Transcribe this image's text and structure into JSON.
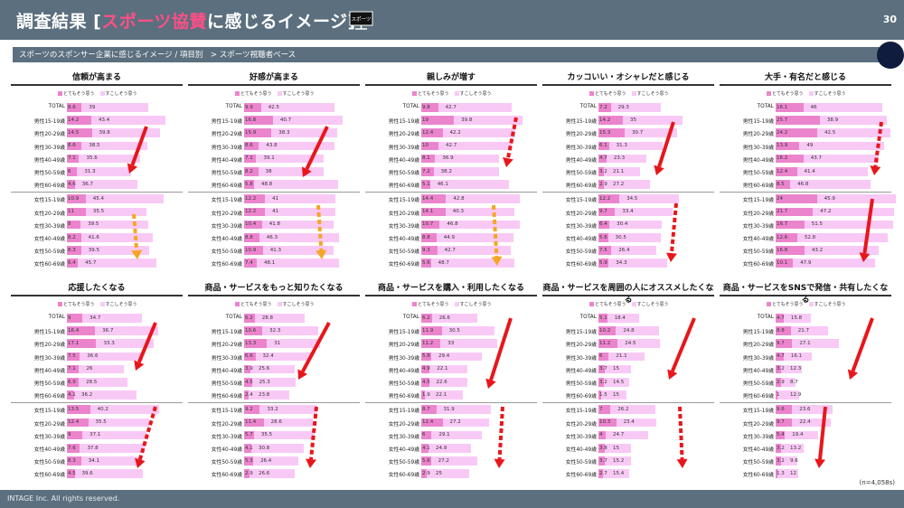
{
  "header": {
    "title_prefix": "調査結果 [",
    "title_highlight": "スポーツ協賛",
    "title_suffix": "に感じるイメージ]",
    "icon_text": "スポーツ",
    "page_number": "30"
  },
  "subtitle": "スポーツのスポンサー企業に感じるイメージ / 項目別　> スポーツ視聴者ベース",
  "legend": {
    "strong": "とてもそう思う",
    "somewhat": "すこしそう思う"
  },
  "colors": {
    "strong": "#ec84cd",
    "somewhat": "#f9c9f6",
    "arrow": "#e8161b",
    "arrow_alt": "#f5a623",
    "header": "#5b6f7e"
  },
  "row_labels": [
    "TOTAL",
    "男性15-19歳",
    "男性20-29歳",
    "男性30-39歳",
    "男性40-49歳",
    "男性50-59歳",
    "男性60-69歳",
    "女性15-19歳",
    "女性20-29歳",
    "女性30-39歳",
    "女性40-49歳",
    "女性50-59歳",
    "女性60-69歳"
  ],
  "chart_data": [
    {
      "type": "bar",
      "title": "信頼が高まる",
      "categories": [
        "TOTAL",
        "男性15-19歳",
        "男性20-29歳",
        "男性30-39歳",
        "男性40-49歳",
        "男性50-59歳",
        "男性60-69歳",
        "女性15-19歳",
        "女性20-29歳",
        "女性30-39歳",
        "女性40-49歳",
        "女性50-59歳",
        "女性60-69歳"
      ],
      "series": [
        {
          "name": "とてもそう思う",
          "values": [
            8.6,
            14.2,
            14.5,
            8.6,
            7.1,
            6.0,
            4.6,
            10.9,
            11.0,
            8.0,
            8.2,
            8.3,
            6.4
          ]
        },
        {
          "name": "すこしそう思う",
          "values": [
            39.0,
            43.4,
            39.8,
            38.5,
            35.6,
            31.3,
            36.7,
            45.4,
            35.5,
            39.5,
            41.6,
            39.5,
            45.7
          ]
        }
      ]
    },
    {
      "type": "bar",
      "title": "好感が高まる",
      "categories": [
        "TOTAL",
        "男性15-19歳",
        "男性20-29歳",
        "男性30-39歳",
        "男性40-49歳",
        "男性50-59歳",
        "男性60-69歳",
        "女性15-19歳",
        "女性20-29歳",
        "女性30-39歳",
        "女性40-49歳",
        "女性50-59歳",
        "女性60-69歳"
      ],
      "series": [
        {
          "name": "とてもそう思う",
          "values": [
            9.9,
            16.8,
            15.9,
            8.6,
            7.1,
            8.2,
            5.8,
            12.2,
            12.2,
            10.4,
            8.8,
            10.9,
            7.4
          ]
        },
        {
          "name": "すこしそう思う",
          "values": [
            42.5,
            40.7,
            38.3,
            43.8,
            39.1,
            38.0,
            48.8,
            41.0,
            41.0,
            41.8,
            46.3,
            41.3,
            48.1
          ]
        }
      ]
    },
    {
      "type": "bar",
      "title": "親しみが増す",
      "categories": [
        "TOTAL",
        "男性15-19歳",
        "男性20-29歳",
        "男性30-39歳",
        "男性40-49歳",
        "男性50-59歳",
        "男性60-69歳",
        "女性15-19歳",
        "女性20-29歳",
        "女性30-39歳",
        "女性40-49歳",
        "女性50-59歳",
        "女性60-69歳"
      ],
      "series": [
        {
          "name": "とてもそう思う",
          "values": [
            9.8,
            19.0,
            12.4,
            10.0,
            8.1,
            7.2,
            5.1,
            14.4,
            14.1,
            10.7,
            8.8,
            9.3,
            5.6
          ]
        },
        {
          "name": "すこしそう思う",
          "values": [
            42.7,
            39.8,
            42.2,
            42.7,
            36.9,
            38.2,
            46.1,
            42.8,
            40.3,
            46.8,
            44.9,
            42.7,
            48.7
          ]
        }
      ]
    },
    {
      "type": "bar",
      "title": "カッコいい・オシャレだと感じる",
      "categories": [
        "TOTAL",
        "男性15-19歳",
        "男性20-29歳",
        "男性30-39歳",
        "男性40-49歳",
        "男性50-59歳",
        "男性60-69歳",
        "女性15-19歳",
        "女性20-29歳",
        "女性30-39歳",
        "女性40-49歳",
        "女性50-59歳",
        "女性60-69歳"
      ],
      "series": [
        {
          "name": "とてもそう思う",
          "values": [
            7.2,
            14.2,
            15.3,
            6.1,
            4.7,
            3.2,
            2.9,
            12.2,
            9.7,
            6.4,
            5.6,
            7.5,
            5.9
          ]
        },
        {
          "name": "すこしそう思う",
          "values": [
            29.3,
            35.0,
            30.7,
            31.3,
            23.3,
            21.1,
            27.2,
            34.5,
            33.4,
            30.4,
            30.5,
            26.4,
            34.3
          ]
        }
      ]
    },
    {
      "type": "bar",
      "title": "大手・有名だと感じる",
      "categories": [
        "TOTAL",
        "男性15-19歳",
        "男性20-29歳",
        "男性30-39歳",
        "男性40-49歳",
        "男性50-59歳",
        "男性60-69歳",
        "女性15-19歳",
        "女性20-29歳",
        "女性30-39歳",
        "女性40-49歳",
        "女性50-59歳",
        "女性60-69歳"
      ],
      "series": [
        {
          "name": "とてもそう思う",
          "values": [
            16.1,
            25.7,
            24.2,
            13.9,
            16.2,
            12.4,
            8.5,
            24.0,
            21.7,
            16.7,
            12.6,
            16.8,
            10.1
          ]
        },
        {
          "name": "すこしそう思う",
          "values": [
            46.0,
            38.9,
            42.5,
            49.0,
            43.7,
            41.4,
            46.8,
            45.9,
            47.2,
            51.5,
            52.8,
            43.2,
            47.9
          ]
        }
      ]
    },
    {
      "type": "bar",
      "title": "応援したくなる",
      "categories": [
        "TOTAL",
        "男性15-19歳",
        "男性20-29歳",
        "男性30-39歳",
        "男性40-49歳",
        "男性50-59歳",
        "男性60-69歳",
        "女性15-19歳",
        "女性20-29歳",
        "女性30-39歳",
        "女性40-49歳",
        "女性50-59歳",
        "女性60-69歳"
      ],
      "series": [
        {
          "name": "とてもそう思う",
          "values": [
            9.0,
            16.4,
            17.1,
            7.5,
            7.1,
            6.9,
            4.1,
            13.5,
            12.4,
            9.0,
            7.6,
            8.3,
            4.5
          ]
        },
        {
          "name": "すこしそう思う",
          "values": [
            34.7,
            36.7,
            33.3,
            36.6,
            26.0,
            28.5,
            36.2,
            40.2,
            35.5,
            37.1,
            37.8,
            34.1,
            39.6
          ]
        }
      ]
    },
    {
      "type": "bar",
      "title": "商品・サービスをもっと知りたくなる",
      "categories": [
        "TOTAL",
        "男性15-19歳",
        "男性20-29歳",
        "男性30-39歳",
        "男性40-49歳",
        "男性50-59歳",
        "男性60-69歳",
        "女性15-19歳",
        "女性20-29歳",
        "女性30-39歳",
        "女性40-49歳",
        "女性50-59歳",
        "女性60-69歳"
      ],
      "series": [
        {
          "name": "とてもそう思う",
          "values": [
            6.2,
            10.6,
            13.3,
            6.6,
            3.9,
            4.5,
            2.4,
            9.2,
            11.4,
            5.7,
            4.1,
            5.3,
            2.9
          ]
        },
        {
          "name": "すこしそう思う",
          "values": [
            28.8,
            32.3,
            31.0,
            32.4,
            25.6,
            25.3,
            23.8,
            33.2,
            28.6,
            35.5,
            30.8,
            26.4,
            26.6
          ]
        }
      ]
    },
    {
      "type": "bar",
      "title": "商品・サービスを購入・利用したくなる",
      "categories": [
        "TOTAL",
        "男性15-19歳",
        "男性20-29歳",
        "男性30-39歳",
        "男性40-49歳",
        "男性50-59歳",
        "男性60-69歳",
        "女性15-19歳",
        "女性20-29歳",
        "女性30-39歳",
        "女性40-49歳",
        "女性50-59歳",
        "女性60-69歳"
      ],
      "series": [
        {
          "name": "とてもそう思う",
          "values": [
            6.2,
            11.9,
            11.2,
            5.8,
            4.9,
            4.5,
            1.9,
            8.7,
            12.4,
            6.0,
            4.1,
            5.6,
            2.9
          ]
        },
        {
          "name": "すこしそう思う",
          "values": [
            26.6,
            30.5,
            33.0,
            29.4,
            22.1,
            22.6,
            22.1,
            31.9,
            27.2,
            29.1,
            24.9,
            27.2,
            25.0
          ]
        }
      ]
    },
    {
      "type": "bar",
      "title": "商品・サービスを周囲の人にオススメしたくなる",
      "categories": [
        "TOTAL",
        "男性15-19歳",
        "男性20-29歳",
        "男性30-39歳",
        "男性40-49歳",
        "男性50-59歳",
        "男性60-69歳",
        "女性15-19歳",
        "女性20-29歳",
        "女性30-39歳",
        "女性40-49歳",
        "女性50-59歳",
        "女性60-69歳"
      ],
      "series": [
        {
          "name": "とてもそう思う",
          "values": [
            5.1,
            10.2,
            11.2,
            6.0,
            3.7,
            3.2,
            1.5,
            7.0,
            10.3,
            4.0,
            3.8,
            3.7,
            2.7
          ]
        },
        {
          "name": "すこしそう思う",
          "values": [
            18.4,
            24.8,
            24.5,
            21.1,
            15.0,
            14.5,
            15.0,
            26.2,
            23.4,
            24.7,
            15.0,
            15.2,
            15.4
          ]
        }
      ]
    },
    {
      "type": "bar",
      "title": "商品・サービスをSNSで発信・共有したくなる",
      "categories": [
        "TOTAL",
        "男性15-19歳",
        "男性20-29歳",
        "男性30-39歳",
        "男性40-49歳",
        "男性50-59歳",
        "男性60-69歳",
        "女性15-19歳",
        "女性20-29歳",
        "女性30-39歳",
        "女性40-49歳",
        "女性50-59歳",
        "女性60-69歳"
      ],
      "series": [
        {
          "name": "とてもそう思う",
          "values": [
            4.7,
            8.8,
            9.7,
            4.7,
            3.2,
            2.9,
            1.0,
            9.6,
            9.7,
            5.4,
            3.2,
            3.2,
            1.3
          ]
        },
        {
          "name": "すこしそう思う",
          "values": [
            15.8,
            21.7,
            27.1,
            16.1,
            12.3,
            8.7,
            12.9,
            23.6,
            22.4,
            19.4,
            13.2,
            9.6,
            12.0
          ]
        }
      ]
    }
  ],
  "note": "(n=4,058s)",
  "footer": "INTAGE Inc. All rights reserved."
}
